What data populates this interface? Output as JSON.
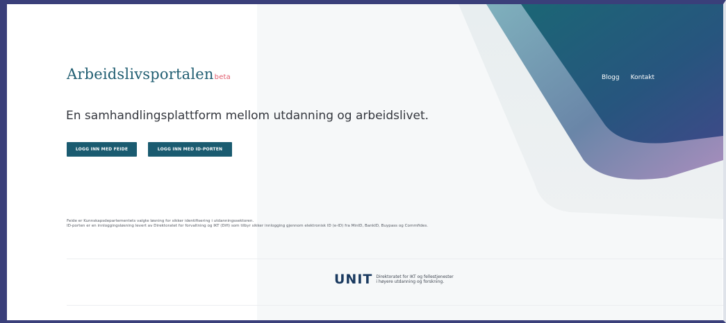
{
  "header": {
    "logo_text": "Arbeidslivsportalen",
    "logo_badge": "beta",
    "nav": [
      {
        "label": "Blogg"
      },
      {
        "label": "Kontakt"
      }
    ]
  },
  "hero": {
    "tagline": "En samhandlingsplattform mellom utdanning og arbeidslivet.",
    "buttons": {
      "feide": "LOGG INN MED FEIDE",
      "idporten": "LOGG INN MED ID-PORTEN"
    }
  },
  "info": {
    "lines": [
      "Feide er Kunnskapsdepartementets valgte løsning for sikker identifisering i utdanningssektoren.",
      "ID-porten er en innloggingsløsning levert av Direktoratet for forvaltning og IKT (Difi) som tilbyr sikker innlogging gjennom elektronisk ID (e-ID) fra MinID, BankID, Buypass og Commfides."
    ]
  },
  "footer": {
    "logo": "UNIT",
    "description_line1": "Direktoratet for IKT og fellestjenester",
    "description_line2": "i høyere utdanning og forskning."
  },
  "colors": {
    "frame": "#3a3f7a",
    "primary_button": "#1a5b70",
    "logo_text": "#1e5c70",
    "beta": "#e05a6b",
    "unit_logo": "#1a3a60"
  }
}
